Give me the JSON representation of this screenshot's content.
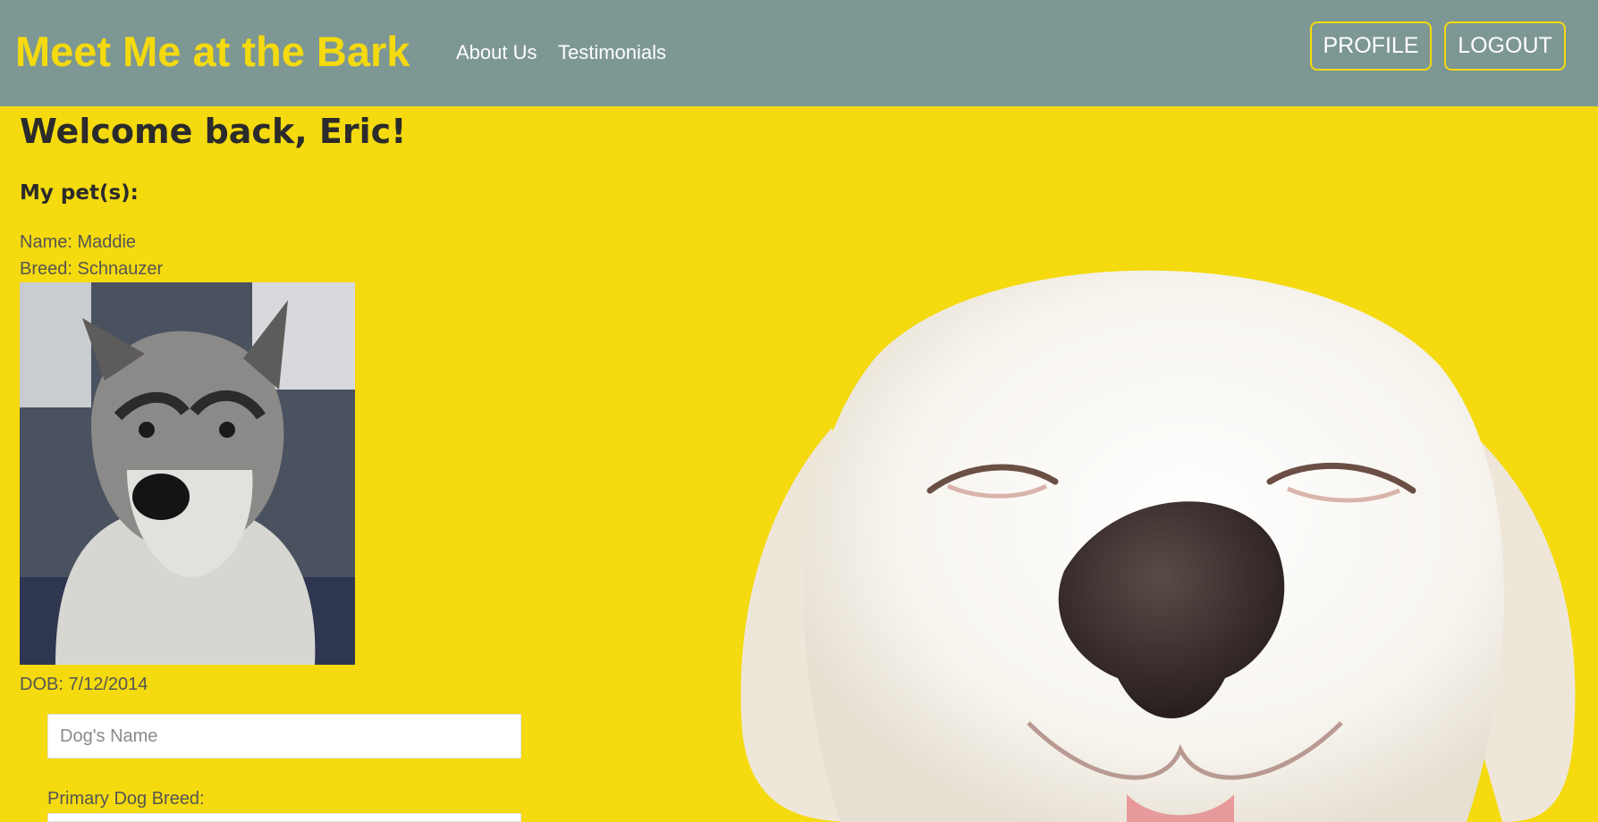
{
  "navbar": {
    "brand": "Meet Me at the Bark",
    "links": [
      "About Us",
      "Testimonials"
    ],
    "buttons": {
      "profile": "PROFILE",
      "logout": "LOGOUT"
    }
  },
  "main": {
    "welcome": "Welcome back, Eric!",
    "pets_heading": "My pet(s):",
    "pet": {
      "name": "Name: Maddie",
      "breed": "Breed: Schnauzer",
      "dob": "DOB: 7/12/2014"
    },
    "form": {
      "dog_name_placeholder": "Dog's Name",
      "breed_label": "Primary Dog Breed:"
    }
  },
  "colors": {
    "navbar": "#7d9794",
    "accent": "#f4da0e",
    "background": "#f4da0e"
  }
}
